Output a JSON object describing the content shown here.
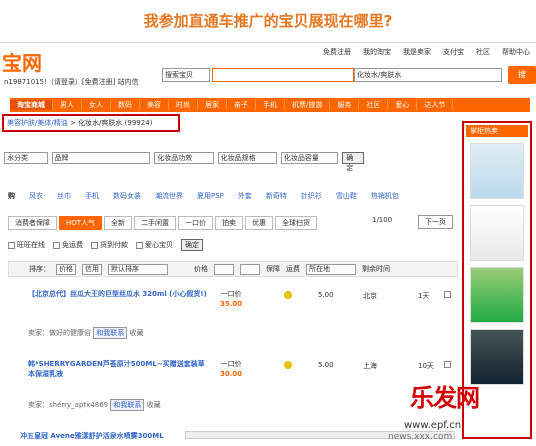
{
  "heading": "我参加直通车推广的宝贝展现在哪里?",
  "header": {
    "logo": "宝网",
    "top_links": [
      "免费注册",
      "我的淘宝",
      "我是卖家",
      "支付宝",
      "社区",
      "帮助中心"
    ],
    "user_line": "n19871015!（请登录）[免费注册] 站内信",
    "search_type": "搜索宝贝",
    "search_query": "",
    "category": "化妆水/爽肤水",
    "search_btn": "搜"
  },
  "nav": [
    "淘宝商城",
    "男人",
    "女人",
    "数码",
    "美容",
    "时尚",
    "居家",
    "亲子",
    "手机",
    "机票/旅游",
    "服务",
    "社区",
    "爱心",
    "达人节"
  ],
  "breadcrumb": {
    "part1": "美容护肤/美体/精油",
    "sep": ">",
    "part2": "化妆水/爽肤水",
    "count": "(99924)"
  },
  "filters": [
    "水分类",
    "品牌",
    "化妆品功效",
    "化妆品规格",
    "化妆品容量"
  ],
  "filter_ok": "确定",
  "cats": [
    "购",
    "风衣",
    "丝巾",
    "手机",
    "数码女装",
    "潮流世界",
    "夏用PSP",
    "外套",
    "新奇特",
    "针织衫",
    "雪山鞋",
    "热销机包"
  ],
  "tabs": [
    "消费者保障",
    "HOT人气",
    "全新",
    "二手闲置",
    "一口价",
    "拍卖",
    "优惠",
    "全球扫货"
  ],
  "pager": {
    "page": "1/100",
    "next": "下一页"
  },
  "checks": [
    "旺旺在线",
    "免运费",
    "货到付款",
    "爱心宝贝",
    "确定"
  ],
  "sortbar": {
    "sort": "排序：",
    "price": "价格",
    "credit": "信用",
    "default": "默认排序",
    "price_label": "价格",
    "guarantee": "保障",
    "shipping": "运费",
    "location": "所在地",
    "remain": "剩余时间"
  },
  "rows": [
    {
      "name": "【北京总代】丝瓜大王的巨型丝瓜水 320ml (小心假货!)",
      "seller": "卖家：做好的健康俗",
      "wang": "和我联系",
      "fav": "收藏",
      "price_type": "一口价",
      "price": "35.00",
      "score": "5.00",
      "city": "北京",
      "days": "1天"
    },
    {
      "name": "韩*SHERRYGARDEN芦荟原汁500ML~买赠送套装草本保湿乳液",
      "seller": "卖家：sherry_aptx4869",
      "wang": "和我联系",
      "fav": "收藏",
      "price_type": "一口价",
      "price": "30.00",
      "score": "5.00",
      "city": "上海",
      "days": "10天"
    }
  ],
  "bottom_row": "冲五皇冠 Avene雅漾舒护活泉水喷雾300ML",
  "side": {
    "title": "掌柜热卖"
  },
  "watermark": {
    "brand": "乐发网",
    "url": "www.epf.cn",
    "url2": "news.xxx.com"
  }
}
